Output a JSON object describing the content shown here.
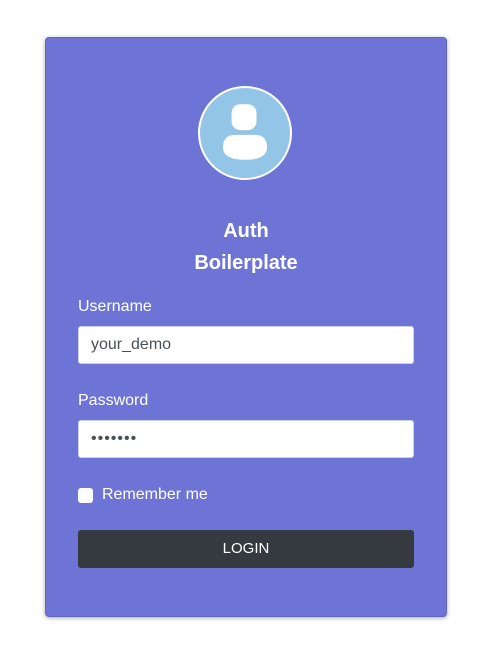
{
  "brand": {
    "line1": "Auth",
    "line2": "Boilerplate"
  },
  "avatar": {
    "icon": "user-icon",
    "background": "#93c5e6"
  },
  "form": {
    "username": {
      "label": "Username",
      "value": "your_demo"
    },
    "password": {
      "label": "Password",
      "value": "•••••••"
    },
    "remember": {
      "label": "Remember me",
      "checked": false
    },
    "login_label": "LOGIN"
  },
  "colors": {
    "card_background": "#6e74d6",
    "button_background": "#343a40",
    "text": "#ffffff"
  }
}
